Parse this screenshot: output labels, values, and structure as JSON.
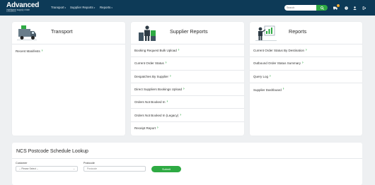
{
  "brand": {
    "name": "Advanced",
    "tagline": "intelligent supply chain",
    "sub": "software/ltd."
  },
  "nav": [
    {
      "label": "Transport"
    },
    {
      "label": "Supplier Reports"
    },
    {
      "label": "Reports"
    }
  ],
  "search": {
    "placeholder": "Search"
  },
  "notifications": {
    "count": "2"
  },
  "cards": [
    {
      "title": "Transport",
      "items": [
        "Recent Manifests"
      ]
    },
    {
      "title": "Supplier Reports",
      "items": [
        "Booking Request Bulk Upload",
        "Current Order Status",
        "Despatches By Supplier",
        "Direct Suppliers Bookings Upload",
        "Orders Not Booked In",
        "Orders Not Booked In (Legacy)",
        "Receipt Report"
      ]
    },
    {
      "title": "Reports",
      "items": [
        "Current Order Status By Destination",
        "Outbound Order Status Summary",
        "Query Log",
        "Supplier Dashboard"
      ]
    }
  ],
  "ncs": {
    "title": "NCS Postcode Schedule Lookup",
    "customer_label": "Customer",
    "customer_value": "-- Please Select --",
    "postcode_label": "Postcode",
    "postcode_placeholder": "Postcode",
    "submit_label": "Submit"
  },
  "colors": {
    "topbar": "#0d3a57",
    "accent": "#2eaa43",
    "badge": "#f2a11b",
    "background": "#eef0f2"
  }
}
